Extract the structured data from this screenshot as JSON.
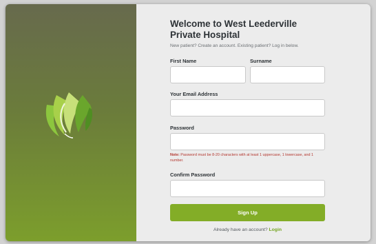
{
  "brand": {
    "logo_icon": "leaf-flame-logo-icon",
    "accent_color": "#83ad27"
  },
  "form": {
    "title": "Welcome to West Leederville Private Hospital",
    "subtitle": "New patient? Create an account. Existing patient? Log in below.",
    "first_name": {
      "label": "First Name",
      "value": "",
      "placeholder": ""
    },
    "surname": {
      "label": "Surname",
      "value": "",
      "placeholder": ""
    },
    "email": {
      "label": "Your Email Address",
      "value": "",
      "placeholder": ""
    },
    "password": {
      "label": "Password",
      "value": "",
      "placeholder": ""
    },
    "note_prefix": "Note:",
    "note_text": "Password must be 8-20 characters with at least 1 uppercase, 1 lowercase, and 1 number.",
    "confirm_password": {
      "label": "Confirm Password",
      "value": "",
      "placeholder": ""
    },
    "submit_label": "Sign Up",
    "login_prompt": "Already have an account?",
    "login_link": "Login",
    "note_color": "#b3362e"
  }
}
